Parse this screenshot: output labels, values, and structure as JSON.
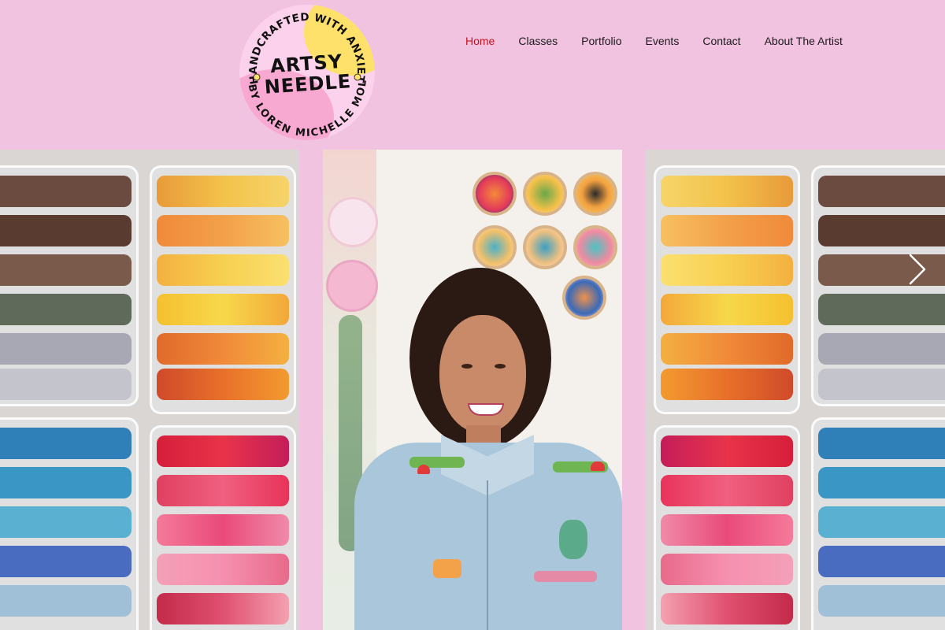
{
  "logo": {
    "ring_top": "HANDCRAFTED WITH ANXIETY",
    "ring_bottom": "BY LOREN MICHELLE MOLY",
    "line1": "ARTSY",
    "line2": "NEEDLE"
  },
  "nav": {
    "items": [
      {
        "label": "Home",
        "active": true
      },
      {
        "label": "Classes"
      },
      {
        "label": "Portfolio"
      },
      {
        "label": "Events"
      },
      {
        "label": "Contact"
      },
      {
        "label": "About The Artist"
      }
    ]
  },
  "gallery": {
    "next_icon": "chevron-right-icon",
    "images": [
      {
        "name": "embroidery floss organizer boxes"
      },
      {
        "name": "artist portrait in denim shirt"
      },
      {
        "name": "embroidery floss organizer boxes"
      }
    ]
  },
  "colors": {
    "background": "#f1c3e1",
    "nav_active": "#c2141f",
    "nav_text": "#1a1a1a"
  }
}
